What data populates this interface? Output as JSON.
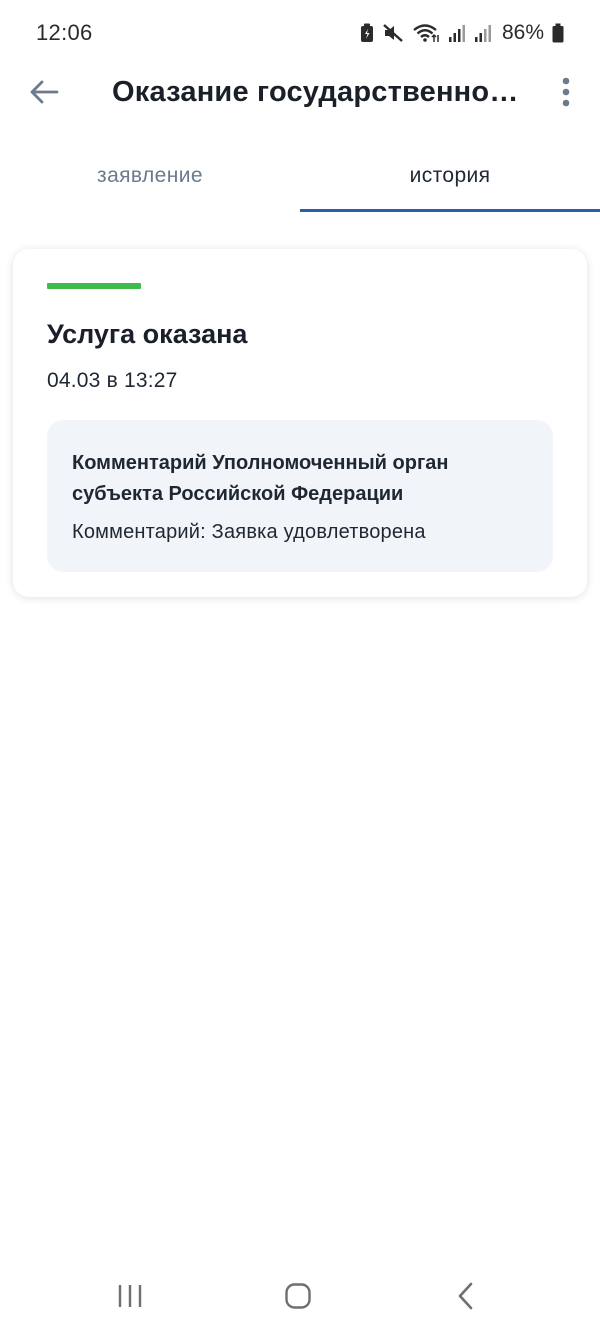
{
  "status_bar": {
    "time": "12:06",
    "battery": "86%",
    "icons": [
      "battery-saver-icon",
      "mute-icon",
      "wifi-icon",
      "signal-icon",
      "signal-icon",
      "battery-icon"
    ]
  },
  "app_bar": {
    "back_icon": "arrow-left-icon",
    "title": "Оказание государственной услуги",
    "more_icon": "more-vertical-icon"
  },
  "tabs": [
    {
      "label": "заявление",
      "active": false
    },
    {
      "label": "история",
      "active": true
    }
  ],
  "history": {
    "status_color": "#3dbb4b",
    "status": "Услуга оказана",
    "date": "04.03 в 13:27",
    "comment_heading": "Комментарий Уполномоченный орган субъекта Российской Федерации",
    "comment_text": "Комментарий: Заявка удовлетворена"
  },
  "nav_bar": {
    "icons": [
      "recent-apps-icon",
      "home-icon",
      "back-icon"
    ]
  },
  "colors": {
    "accent": "#2a5ea8",
    "comment_bg": "#f1f5fa"
  }
}
